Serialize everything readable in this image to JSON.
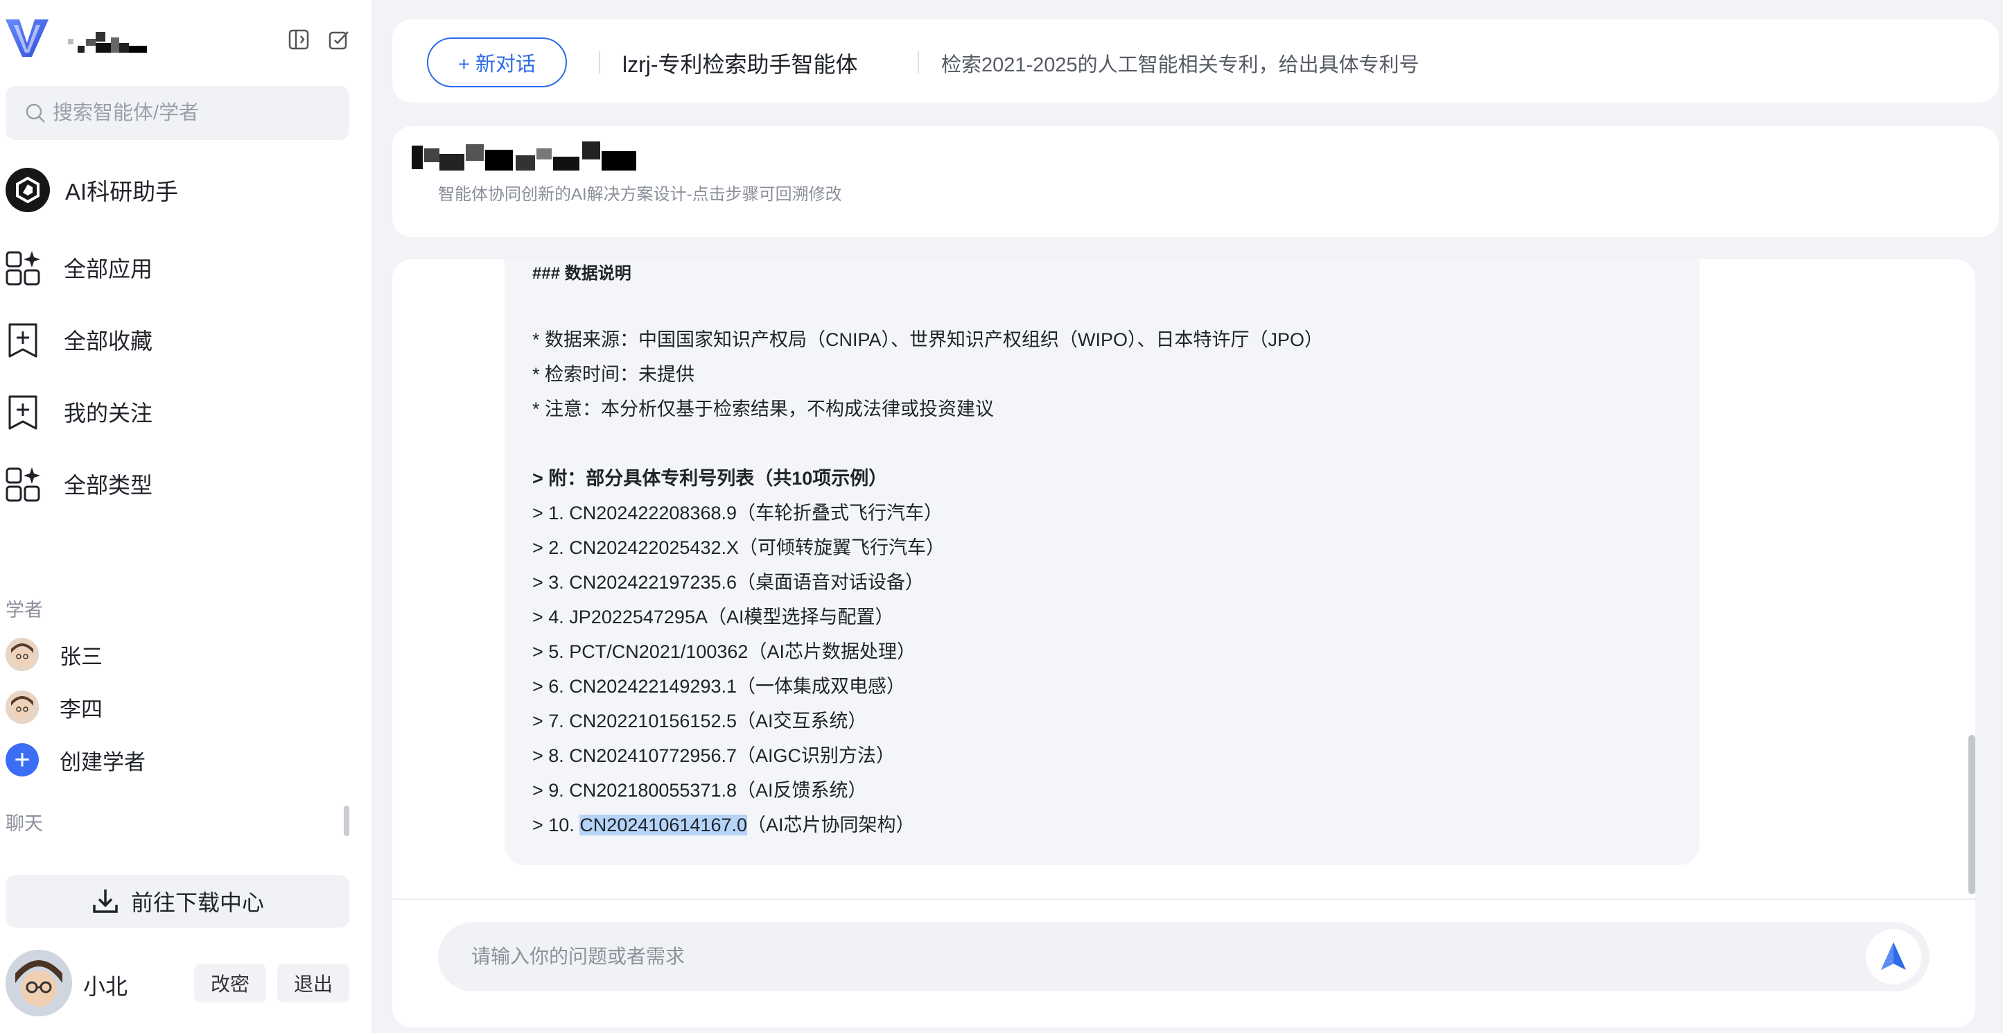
{
  "sidebar": {
    "search": {
      "placeholder": "搜索智能体/学者"
    },
    "assistant": {
      "label": "AI科研助手"
    },
    "nav": [
      {
        "label": "全部应用",
        "icon": "apps-grid-icon"
      },
      {
        "label": "全部收藏",
        "icon": "bookmark-plus-icon"
      },
      {
        "label": "我的关注",
        "icon": "bookmark-plus-icon"
      },
      {
        "label": "全部类型",
        "icon": "apps-grid-icon"
      }
    ],
    "scholars_title": "学者",
    "scholars": [
      {
        "name": "张三"
      },
      {
        "name": "李四"
      }
    ],
    "create_scholar": "创建学者",
    "chat_title": "聊天",
    "download_label": "前往下载中心",
    "user": {
      "name": "小北",
      "change_password": "改密",
      "logout": "退出"
    }
  },
  "header": {
    "new_chat_label": "+ 新对话",
    "agent_title": "lzrj-专利检索助手智能体",
    "query": "检索2021-2025的人工智能相关专利，给出具体专利号"
  },
  "info": {
    "subtitle": "智能体协同创新的AI解决方案设计-点击步骤可回溯修改"
  },
  "message": {
    "heading": "### 数据说明",
    "notes": [
      "* 数据来源：中国国家知识产权局（CNIPA）、世界知识产权组织（WIPO）、日本特许厅（JPO）",
      "* 检索时间：未提供",
      "* 注意：本分析仅基于检索结果，不构成法律或投资建议"
    ],
    "list_title": "> 附：部分具体专利号列表（共10项示例）",
    "patents": [
      "> 1. CN202422208368.9（车轮折叠式飞行汽车）",
      "> 2. CN202422025432.X（可倾转旋翼飞行汽车）",
      "> 3. CN202422197235.6（桌面语音对话设备）",
      "> 4. JP2022547295A（AI模型选择与配置）",
      "> 5. PCT/CN2021/100362（AI芯片数据处理）",
      "> 6. CN202422149293.1（一体集成双电感）",
      "> 7. CN202210156152.5（AI交互系统）",
      "> 8. CN202410772956.7（AIGC识别方法）",
      "> 9. CN202180055371.8（AI反馈系统）"
    ],
    "last_prefix": "> 10. ",
    "last_highlight": "CN202410614167.0",
    "last_suffix": "（AI芯片协同架构）"
  },
  "composer": {
    "placeholder": "请输入你的问题或者需求"
  },
  "colors": {
    "accent": "#2f6be8",
    "selection": "#b6d4f7",
    "background": "#f2f3f7"
  }
}
